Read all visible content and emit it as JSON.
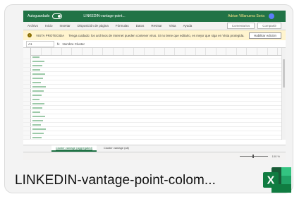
{
  "file": {
    "name": "LINKEDIN-vantage-point-colom...",
    "app_icon": "excel-icon",
    "colors": {
      "excel_green": "#217346",
      "excel_dark": "#185c37",
      "excel_light": "#33c481"
    }
  },
  "thumbnail": {
    "titlebar": {
      "autosave": "Autoguardado",
      "title": "LINKEDIN-vantage-point...",
      "user": "Adrian Villanueva Soria"
    },
    "menu": [
      "Archivo",
      "Inicio",
      "Insertar",
      "Disposición de página",
      "Fórmulas",
      "Datos",
      "Revisar",
      "Vista",
      "Ayuda"
    ],
    "menu_buttons": [
      "Comentarios",
      "Compartir"
    ],
    "info": {
      "label": "VISTA PROTEGIDA",
      "message": "Tenga cuidado: los archivos de Internet pueden contener virus. Si no tiene que editarlo, es mejor que siga en Vista protegida.",
      "button": "Habilitar edición"
    },
    "formula": {
      "cell": "A1",
      "fx": "fx",
      "value": "Nombre Cluster"
    },
    "sheets": [
      "Cluster vantage (aggregated)",
      "Cluster vantage (all)"
    ],
    "status": {
      "zoom": "100 %"
    }
  }
}
